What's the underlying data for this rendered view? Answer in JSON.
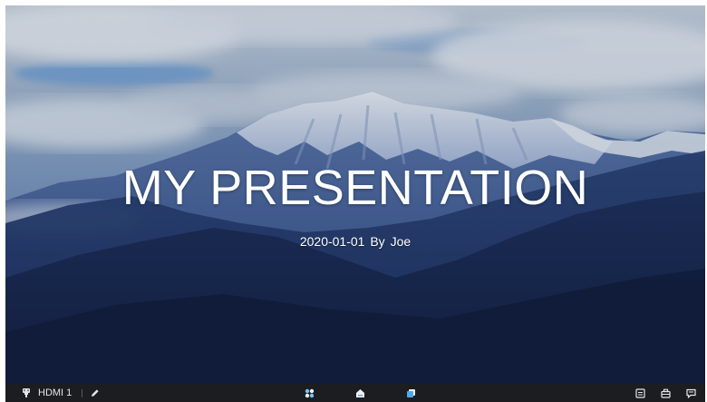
{
  "slide": {
    "title": "MY PRESENTATION",
    "subtitle": "2020-01-01  By Joe"
  },
  "taskbar": {
    "source_label": "HDMI 1",
    "icons": {
      "source": "input-source-icon",
      "annotate": "pen-icon",
      "apps": "apps-grid-icon",
      "home": "home-icon",
      "windows": "windows-icon",
      "right_1": "panel-icon",
      "right_2": "toolbox-icon",
      "right_3": "message-icon"
    }
  },
  "colors": {
    "taskbar_bg": "#1b1d20",
    "apps_icon": "#6ec6ff",
    "windows_icon": "#4fa8f0"
  }
}
